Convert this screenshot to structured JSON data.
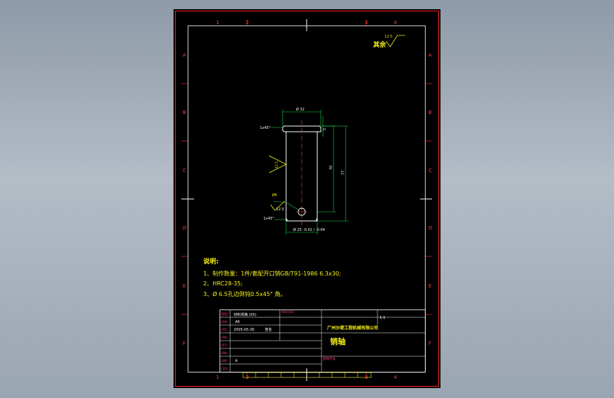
{
  "drawing": {
    "surface_roughness": {
      "label": "其余",
      "value": "12.5"
    },
    "zone_columns": [
      "1",
      "2",
      "3",
      "4"
    ],
    "zone_rows": [
      "A",
      "B",
      "C",
      "D",
      "E",
      "F"
    ],
    "dimensions": {
      "head_diameter": "Ø 32",
      "shank_diameter": "Ø 25",
      "shank_tolerance": "-0.02 / -0.04",
      "top_chamfer": "1x45°",
      "bottom_chamfer": "1x45°",
      "head_thickness": "5",
      "length_inner": "70",
      "length_outer": "77",
      "shank_roughness": "12.5",
      "hole_diameter": "Ø6",
      "hole_roughness": "12.5"
    },
    "notes": {
      "title": "说明:",
      "items": [
        "1、制作数量：1件/套配开口销GB/T91-1986 6.3x30;",
        "2、HRC28-35;",
        "3、Ø 6.5孔边倒钝0.5x45° 角。"
      ]
    },
    "title_block": {
      "company": "广州沙堤工程机械有限公司",
      "part_name": "销轴",
      "material_label": "材料规格 (05)",
      "material_code": "A6",
      "date": "2005-05-30",
      "approved_label": "签名",
      "scale": "1:1",
      "version": "A",
      "drawing_no_label": "图样代号",
      "rev_label": "(06)(02)",
      "left_labels": [
        "(03)",
        "(04)",
        "(05)",
        "(06)",
        "(07)",
        "(08)",
        "(09)",
        "(10)"
      ]
    }
  },
  "colors": {
    "background": "#9aa5b2",
    "sheet": "#000000",
    "border": "#ff2020",
    "inner_frame": "#ffffff",
    "outline": "#19e04a",
    "dimension": "#34d2d8",
    "annotation": "#f5f016"
  }
}
